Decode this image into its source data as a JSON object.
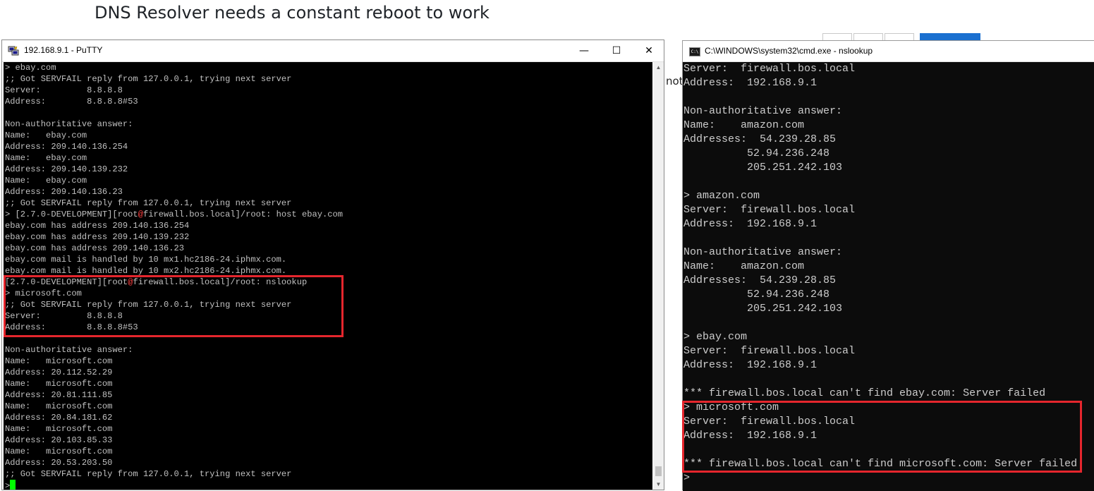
{
  "page": {
    "title": "DNS Resolver needs a constant reboot to work",
    "partial_text": "not"
  },
  "putty": {
    "title": "192.168.9.1 - PuTTY",
    "minimize": "—",
    "maximize": "☐",
    "close": "✕",
    "lines": [
      "> ebay.com",
      ";; Got SERVFAIL reply from 127.0.0.1, trying next server",
      "Server:         8.8.8.8",
      "Address:        8.8.8.8#53",
      "",
      "Non-authoritative answer:",
      "Name:   ebay.com",
      "Address: 209.140.136.254",
      "Name:   ebay.com",
      "Address: 209.140.139.232",
      "Name:   ebay.com",
      "Address: 209.140.136.23",
      ";; Got SERVFAIL reply from 127.0.0.1, trying next server",
      "> [2.7.0-DEVELOPMENT][root@firewall.bos.local]/root: host ebay.com",
      "ebay.com has address 209.140.136.254",
      "ebay.com has address 209.140.139.232",
      "ebay.com has address 209.140.136.23",
      "ebay.com mail is handled by 10 mx1.hc2186-24.iphmx.com.",
      "ebay.com mail is handled by 10 mx2.hc2186-24.iphmx.com.",
      "[2.7.0-DEVELOPMENT][root@firewall.bos.local]/root: nslookup",
      "> microsoft.com",
      ";; Got SERVFAIL reply from 127.0.0.1, trying next server",
      "Server:         8.8.8.8",
      "Address:        8.8.8.8#53",
      "",
      "Non-authoritative answer:",
      "Name:   microsoft.com",
      "Address: 20.112.52.29",
      "Name:   microsoft.com",
      "Address: 20.81.111.85",
      "Name:   microsoft.com",
      "Address: 20.84.181.62",
      "Name:   microsoft.com",
      "Address: 20.103.85.33",
      "Name:   microsoft.com",
      "Address: 20.53.203.50",
      ";; Got SERVFAIL reply from 127.0.0.1, trying next server",
      ">"
    ]
  },
  "cmd": {
    "title": "C:\\WINDOWS\\system32\\cmd.exe - nslookup",
    "icon_text": "C:\\",
    "lines": [
      "Server:  firewall.bos.local",
      "Address:  192.168.9.1",
      "",
      "Non-authoritative answer:",
      "Name:    amazon.com",
      "Addresses:  54.239.28.85",
      "          52.94.236.248",
      "          205.251.242.103",
      "",
      "> amazon.com",
      "Server:  firewall.bos.local",
      "Address:  192.168.9.1",
      "",
      "Non-authoritative answer:",
      "Name:    amazon.com",
      "Addresses:  54.239.28.85",
      "          52.94.236.248",
      "          205.251.242.103",
      "",
      "> ebay.com",
      "Server:  firewall.bos.local",
      "Address:  192.168.9.1",
      "",
      "*** firewall.bos.local can't find ebay.com: Server failed",
      "> microsoft.com",
      "Server:  firewall.bos.local",
      "Address:  192.168.9.1",
      "",
      "*** firewall.bos.local can't find microsoft.com: Server failed",
      ">"
    ]
  },
  "colors": {
    "highlight": "#e5262d",
    "cursor": "#00ff00",
    "at_sign": "#ff4040"
  }
}
